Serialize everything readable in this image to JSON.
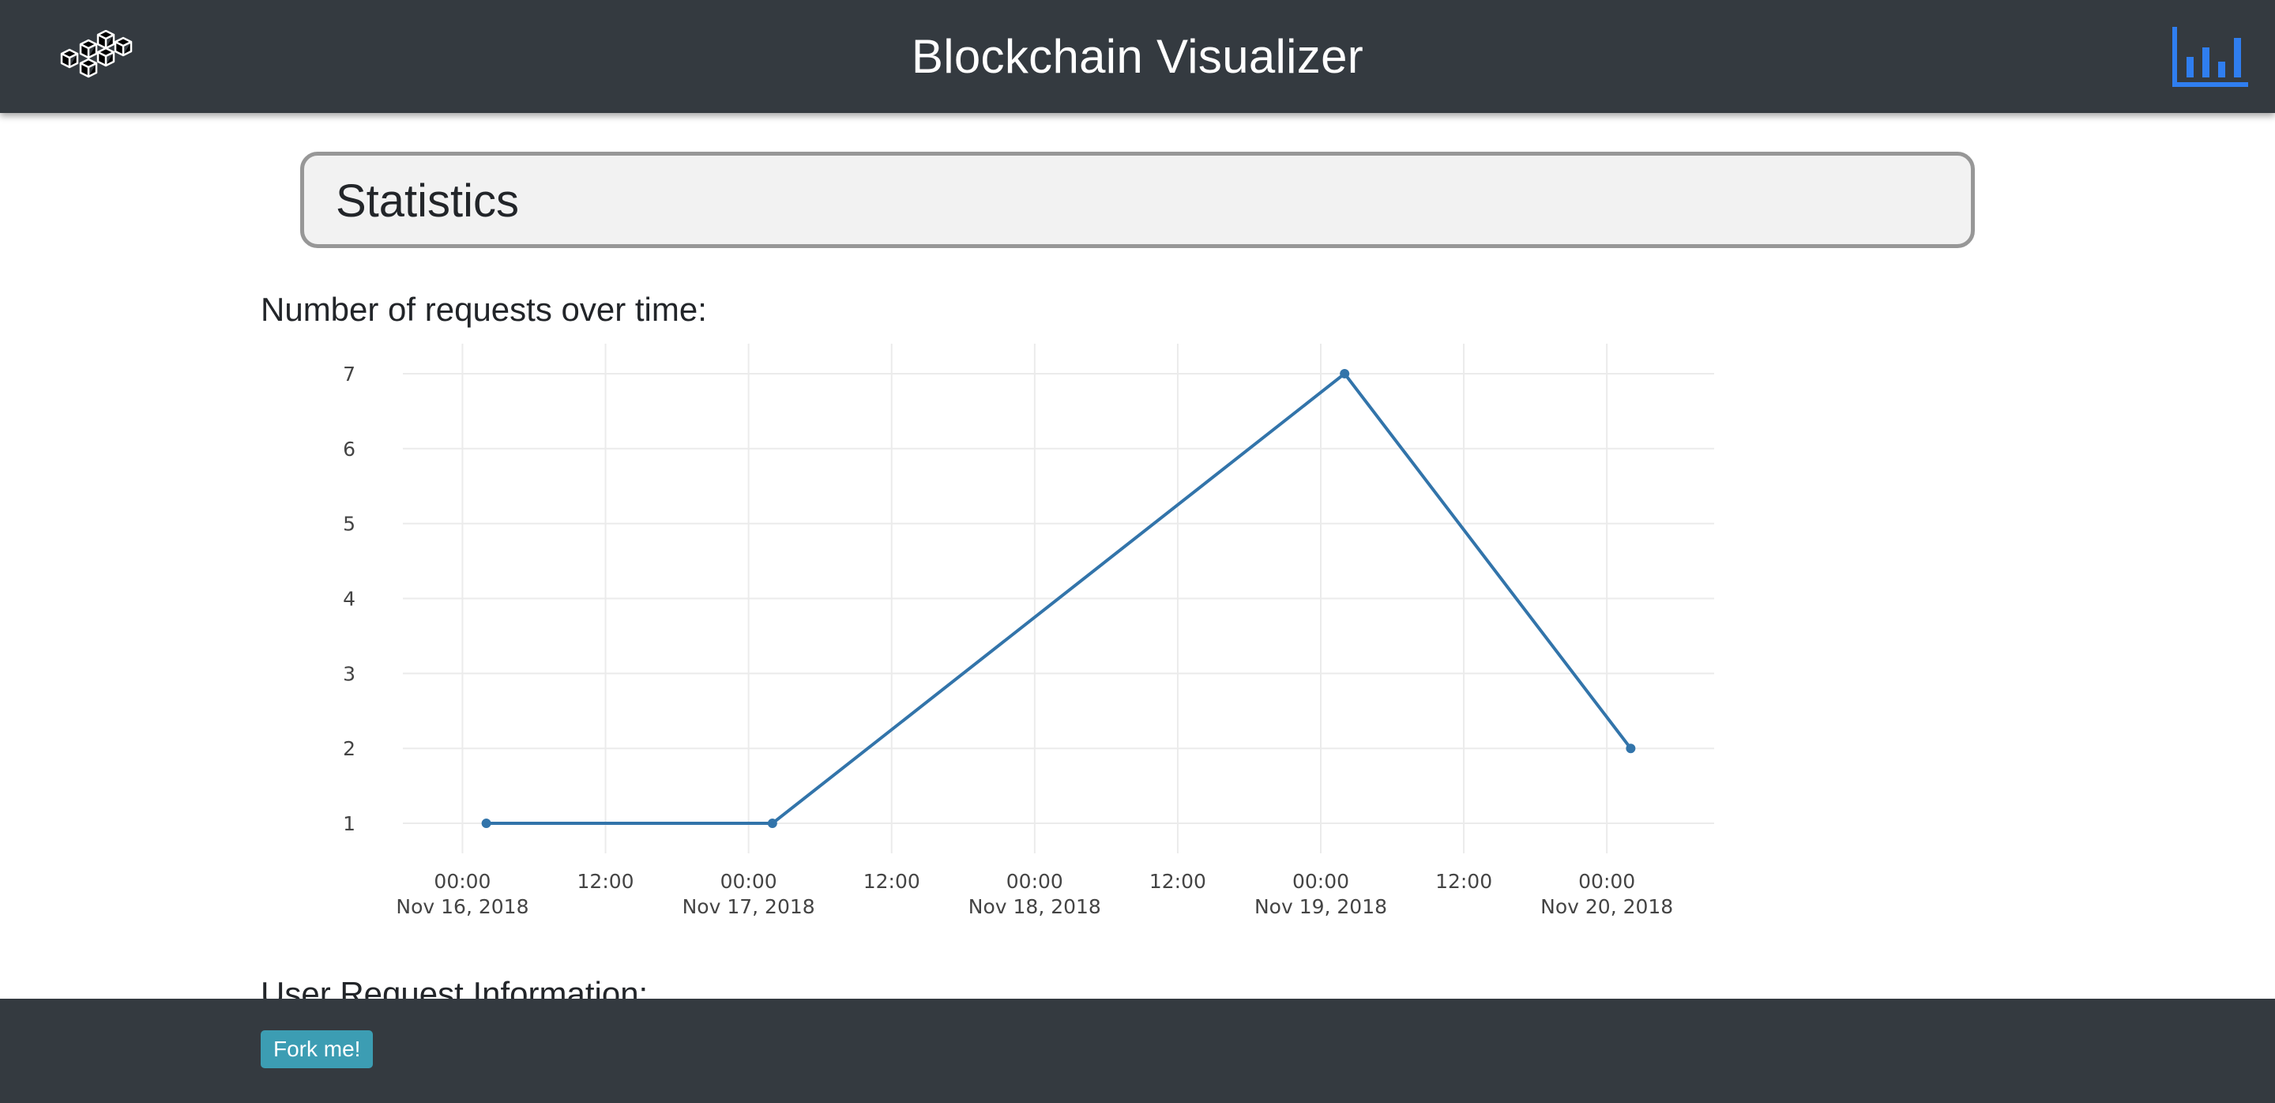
{
  "header": {
    "title": "Blockchain Visualizer",
    "logo_icon": "blocks-cubes-icon",
    "stats_icon": "bar-chart-icon",
    "accent_color": "#2f7ef0"
  },
  "statistics": {
    "section_title": "Statistics",
    "chart_heading": "Number of requests over time:"
  },
  "chart_data": {
    "type": "line",
    "title": "Number of requests over time:",
    "xlabel": "",
    "ylabel": "",
    "x": [
      "2018-11-16T02:00",
      "2018-11-17T02:00",
      "2018-11-19T02:00",
      "2018-11-20T02:00"
    ],
    "values": [
      1,
      1,
      7,
      2
    ],
    "ylim": [
      0.6,
      7.4
    ],
    "xlim": [
      "2018-11-15T19:00",
      "2018-11-20T09:00"
    ],
    "y_ticks": [
      "1",
      "2",
      "3",
      "4",
      "5",
      "6",
      "7"
    ],
    "x_ticks": [
      {
        "time": "00:00",
        "date": "Nov 16, 2018"
      },
      {
        "time": "12:00",
        "date": ""
      },
      {
        "time": "00:00",
        "date": "Nov 17, 2018"
      },
      {
        "time": "12:00",
        "date": ""
      },
      {
        "time": "00:00",
        "date": "Nov 18, 2018"
      },
      {
        "time": "12:00",
        "date": ""
      },
      {
        "time": "00:00",
        "date": "Nov 19, 2018"
      },
      {
        "time": "12:00",
        "date": ""
      },
      {
        "time": "00:00",
        "date": "Nov 20, 2018"
      }
    ],
    "grid": true,
    "legend": "none",
    "line_color": "#3274aa"
  },
  "user_requests": {
    "heading": "User Request Information:"
  },
  "footer": {
    "fork_label": "Fork me!"
  }
}
